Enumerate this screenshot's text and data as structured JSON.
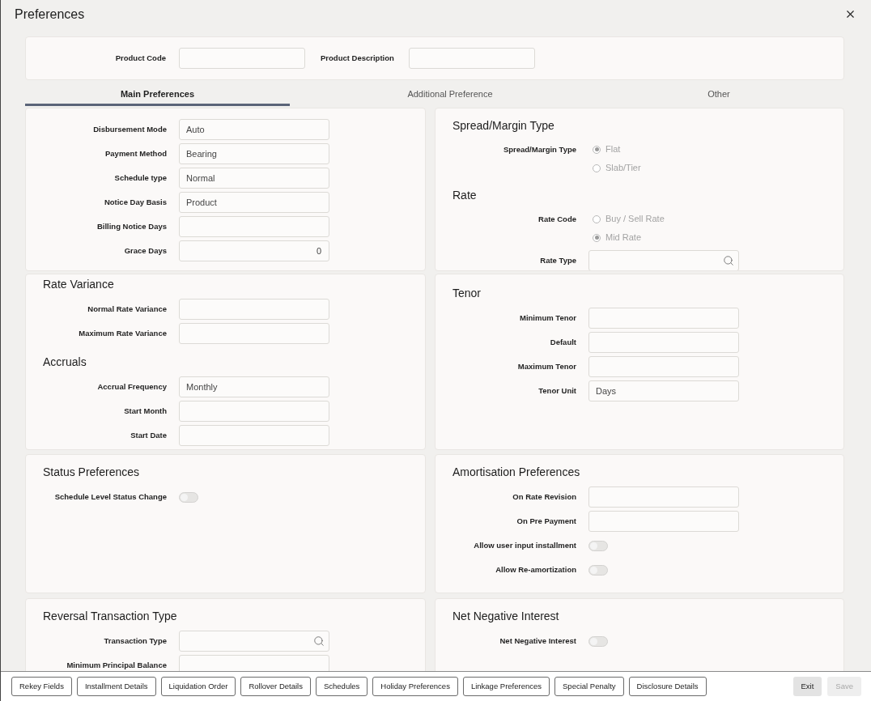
{
  "window": {
    "title": "Preferences"
  },
  "header": {
    "fields": [
      {
        "label": "Product Code"
      },
      {
        "label": "Product Description"
      }
    ]
  },
  "tabs": [
    {
      "label": "Main Preferences",
      "selected": true
    },
    {
      "label": "Additional Preference",
      "selected": false
    },
    {
      "label": "Other",
      "selected": false
    }
  ],
  "rows": [
    {
      "panels": [
        {
          "sections": [
            {
              "fields": [
                {
                  "kind": "text",
                  "label": "Disbursement Mode",
                  "value": "Auto"
                },
                {
                  "kind": "text",
                  "label": "Payment Method",
                  "value": "Bearing"
                },
                {
                  "kind": "text",
                  "label": "Schedule type",
                  "value": "Normal"
                },
                {
                  "kind": "text",
                  "label": "Notice Day Basis",
                  "value": "Product"
                },
                {
                  "kind": "text",
                  "label": "Billing Notice Days"
                },
                {
                  "kind": "number",
                  "label": "Grace Days",
                  "value": "0"
                }
              ]
            }
          ]
        },
        {
          "sections": [
            {
              "heading": "Spread/Margin Type",
              "fields": [
                {
                  "kind": "radio",
                  "label": "Spread/Margin Type",
                  "options": [
                    {
                      "label": "Flat",
                      "selected": true,
                      "disabled": true
                    },
                    {
                      "label": "Slab/Tier",
                      "selected": false,
                      "disabled": true
                    }
                  ]
                }
              ]
            },
            {
              "heading": "Rate",
              "fields": [
                {
                  "kind": "radio",
                  "label": "Rate Code",
                  "options": [
                    {
                      "label": "Buy / Sell Rate",
                      "selected": false,
                      "disabled": true
                    },
                    {
                      "label": "Mid Rate",
                      "selected": true,
                      "disabled": true
                    }
                  ]
                },
                {
                  "kind": "search",
                  "label": "Rate Type"
                }
              ]
            }
          ]
        }
      ]
    },
    {
      "panels": [
        {
          "sections": [
            {
              "heading": "Rate Variance",
              "fields": [
                {
                  "kind": "text",
                  "label": "Normal Rate Variance"
                },
                {
                  "kind": "text",
                  "label": "Maximum Rate Variance"
                }
              ]
            },
            {
              "heading": "Accruals",
              "fields": [
                {
                  "kind": "text",
                  "label": "Accrual Frequency",
                  "value": "Monthly"
                },
                {
                  "kind": "text",
                  "label": "Start Month"
                },
                {
                  "kind": "text",
                  "label": "Start Date"
                }
              ]
            }
          ]
        },
        {
          "sections": [
            {
              "heading": "Tenor",
              "fields": [
                {
                  "kind": "text",
                  "label": "Minimum Tenor"
                },
                {
                  "kind": "text",
                  "label": "Default"
                },
                {
                  "kind": "text",
                  "label": "Maximum Tenor"
                },
                {
                  "kind": "text",
                  "label": "Tenor Unit",
                  "value": "Days"
                }
              ]
            }
          ]
        }
      ]
    },
    {
      "panels": [
        {
          "sections": [
            {
              "heading": "Status Preferences",
              "fields": [
                {
                  "kind": "toggle",
                  "label": "Schedule Level Status Change",
                  "on": false
                }
              ]
            }
          ]
        },
        {
          "sections": [
            {
              "heading": "Amortisation Preferences",
              "fields": [
                {
                  "kind": "text",
                  "label": "On Rate Revision"
                },
                {
                  "kind": "text",
                  "label": "On Pre Payment"
                },
                {
                  "kind": "toggle",
                  "label": "Allow user input installment",
                  "on": false
                },
                {
                  "kind": "toggle",
                  "label": "Allow Re-amortization",
                  "on": false
                }
              ]
            }
          ]
        }
      ]
    },
    {
      "panels": [
        {
          "sections": [
            {
              "heading": "Reversal Transaction Type",
              "fields": [
                {
                  "kind": "search",
                  "label": "Transaction Type"
                },
                {
                  "kind": "text",
                  "label": "Minimum Principal Balance"
                }
              ]
            }
          ]
        },
        {
          "sections": [
            {
              "heading": "Net Negative Interest",
              "fields": [
                {
                  "kind": "toggle",
                  "label": "Net Negative Interest",
                  "on": false
                }
              ]
            }
          ]
        }
      ]
    }
  ],
  "footer": {
    "buttons": [
      "Rekey Fields",
      "Installment Details",
      "Liquidation Order",
      "Rollover Details",
      "Schedules",
      "Holiday Preferences",
      "Linkage Preferences",
      "Special Penalty",
      "Disclosure Details"
    ],
    "actions": [
      {
        "label": "Exit",
        "disabled": false
      },
      {
        "label": "Save",
        "disabled": true
      }
    ]
  }
}
